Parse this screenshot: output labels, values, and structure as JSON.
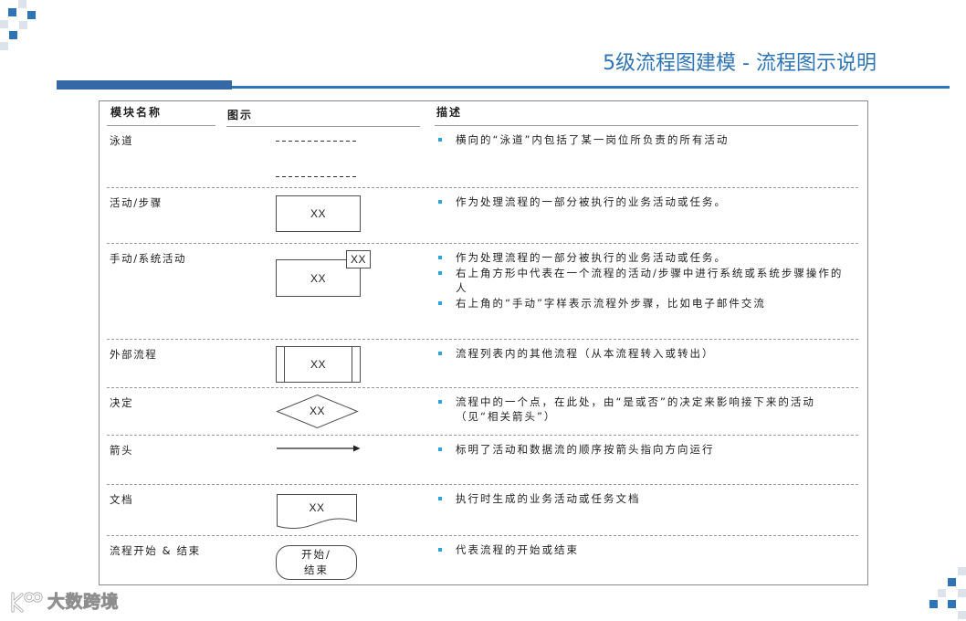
{
  "slide": {
    "title": "5级流程图建模 - 流程图示说明"
  },
  "colors": {
    "accent": "#2f75b5",
    "accent_dark": "#3569a6",
    "bullet": "#2ba3dc",
    "decor_light": "#dde3ea",
    "text": "#1f1f1f",
    "rule": "#9a9a9a",
    "frame": "#8a8a8a"
  },
  "table": {
    "headers": {
      "module": "模块名称",
      "symbol": "图示",
      "description": "描述"
    },
    "rows": [
      {
        "module": "泳道",
        "symbol_icon": "swimlane-icon",
        "description": [
          "横向的“泳道”内包括了某一岗位所负责的所有活动"
        ]
      },
      {
        "module": "活动/步骤",
        "symbol_icon": "activity-box-icon",
        "symbol_text": "XX",
        "description": [
          "作为处理流程的一部分被执行的业务活动或任务。"
        ]
      },
      {
        "module": "手动/系统活动",
        "symbol_icon": "manual-activity-icon",
        "symbol_text": "XX",
        "corner_text": "XX",
        "description": [
          "作为处理流程的一部分被执行的业务活动或任务。",
          "右上角方形中代表在一个流程的活动/步骤中进行系统或系统步骤操作的人",
          "右上角的“手动”字样表示流程外步骤，比如电子邮件交流"
        ]
      },
      {
        "module": "外部流程",
        "symbol_icon": "external-process-icon",
        "symbol_text": "XX",
        "description": [
          "流程列表内的其他流程（从本流程转入或转出）"
        ]
      },
      {
        "module": "决定",
        "symbol_icon": "decision-diamond-icon",
        "symbol_text": "XX",
        "description": [
          "流程中的一个点，在此处，由“是或否”的决定来影响接下来的活动（见“相关箭头”）"
        ]
      },
      {
        "module": "箭头",
        "symbol_icon": "arrow-icon",
        "description": [
          "标明了活动和数据流的顺序按箭头指向方向运行"
        ]
      },
      {
        "module": "文档",
        "symbol_icon": "document-icon",
        "symbol_text": "XX",
        "description": [
          "执行时生成的业务活动或任务文档"
        ]
      },
      {
        "module": "流程开始 & 结束",
        "symbol_icon": "terminator-icon",
        "symbol_text": [
          "开始/",
          "结束"
        ],
        "description": [
          "代表流程的开始或结束"
        ]
      }
    ]
  },
  "watermark": {
    "logo_icon": "dashu-logo-icon",
    "brand": "大数跨境"
  }
}
